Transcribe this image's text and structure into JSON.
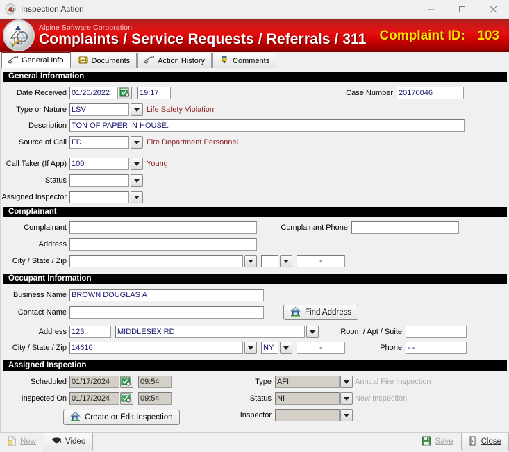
{
  "window": {
    "title": "Inspection Action",
    "minimize": "–",
    "maximize": "□",
    "close": "✕"
  },
  "banner": {
    "corporation": "Alpine Software Corporation",
    "title": "Complaints  /  Service Requests  /  Referrals  /  311",
    "complaint_id_label": "Complaint ID:",
    "complaint_id_value": "103",
    "accent_red": "#c20000",
    "accent_yellow": "#ffe100"
  },
  "tabs": [
    {
      "label": "General Info",
      "icon": "phone-icon",
      "active": true
    },
    {
      "label": "Documents",
      "icon": "folder-icon",
      "active": false
    },
    {
      "label": "Action History",
      "icon": "phone-icon",
      "active": false
    },
    {
      "label": "Comments",
      "icon": "pencil-icon",
      "active": false
    }
  ],
  "general": {
    "section": "General Information",
    "date_received_label": "Date Received",
    "date_received_value": "01/20/2022",
    "time_received_value": "19:17",
    "case_number_label": "Case Number",
    "case_number_value": "20170046",
    "type_label": "Type or Nature",
    "type_value": "LSV",
    "type_hint": "Life Safety Violation",
    "description_label": "Description",
    "description_value": "TON OF PAPER IN HOUSE.",
    "source_label": "Source of Call",
    "source_value": "FD",
    "source_hint": "Fire Department Personnel",
    "calltaker_label": "Call Taker (If App)",
    "calltaker_value": "100",
    "calltaker_hint": "Young",
    "status_label": "Status",
    "status_value": "",
    "inspector_label": "Assigned Inspector",
    "inspector_value": ""
  },
  "complainant": {
    "section": "Complainant",
    "name_label": "Complainant",
    "name_value": "",
    "phone_label": "Complainant Phone",
    "phone_value": "",
    "address_label": "Address",
    "address_value": "",
    "citystatezip_label": "City / State / Zip",
    "city_value": "",
    "state_value": "",
    "zip_value": "-"
  },
  "occupant": {
    "section": "Occupant Information",
    "business_label": "Business Name",
    "business_value": "BROWN DOUGLAS A",
    "contact_label": "Contact Name",
    "contact_value": "",
    "find_address_label": "Find Address",
    "address_label": "Address",
    "address_number": "123",
    "address_street": "MIDDLESEX RD",
    "room_label": "Room / Apt / Suite",
    "room_value": "",
    "citystatezip_label": "City / State / Zip",
    "city_value": "14610",
    "state_value": "NY",
    "zip_value": "-",
    "phone_label": "Phone",
    "phone_value": "-  -"
  },
  "inspection": {
    "section": "Assigned Inspection",
    "scheduled_label": "Scheduled",
    "scheduled_date": "01/17/2024",
    "scheduled_time": "09:54",
    "inspected_label": "Inspected On",
    "inspected_date": "01/17/2024",
    "inspected_time": "09:54",
    "create_edit_label": "Create or Edit Inspection",
    "type_label": "Type",
    "type_value": "AFI",
    "type_hint": "Annual Fire Inspection",
    "status_label": "Status",
    "status_value": "NI",
    "status_hint": "New Inspection",
    "inspector_label": "Inspector",
    "inspector_value": ""
  },
  "bottombar": {
    "new_label": "New",
    "video_label": "Video",
    "save_label": "Save",
    "close_label": "Close"
  }
}
